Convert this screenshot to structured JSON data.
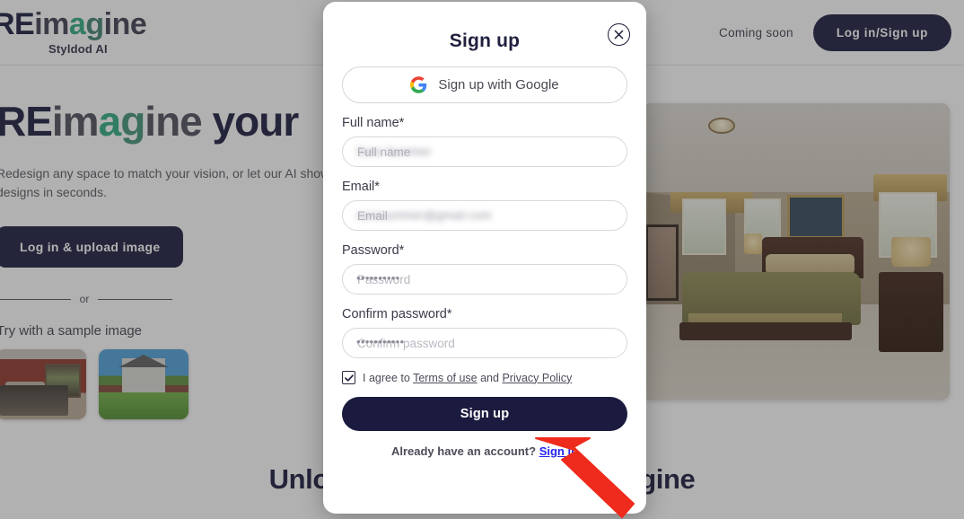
{
  "header": {
    "logo": {
      "part1": "RE",
      "part2": "im",
      "part3": "a",
      "part4": "g",
      "part5": "ine",
      "subtitle": "Styldod AI"
    },
    "coming_soon": "Coming soon",
    "login_button": "Log in/Sign up"
  },
  "hero": {
    "title": {
      "part1": "RE",
      "part2": "im",
      "part3": "a",
      "part4": "g",
      "part5": "ine",
      "part6": " your"
    },
    "subtitle": "Redesign any space to match your vision, or let our AI show you designs in seconds.",
    "cta_button": "Log in & upload image",
    "or_text": "or",
    "sample_label": "Try with a sample image",
    "thumbnails": [
      {
        "name": "red-bedroom-sample"
      },
      {
        "name": "house-exterior-sample"
      }
    ],
    "photo_alt": "bedroom interior photo"
  },
  "bottom": {
    "title": "Unlock creativity with REimagine",
    "subtitle": ""
  },
  "modal": {
    "title": "Sign up",
    "close_icon": "close-circle-icon",
    "google_button": "Sign up with Google",
    "fields": [
      {
        "label": "Full name*",
        "value": "Sara Summer",
        "placeholder": "Full name",
        "redacted": true,
        "type": "text",
        "name": "full-name"
      },
      {
        "label": "Email*",
        "value": "sarasummer@gmail.com",
        "placeholder": "Email",
        "redacted": true,
        "type": "email",
        "name": "email"
      },
      {
        "label": "Password*",
        "value": "••••••••••",
        "placeholder": "Password",
        "redacted": false,
        "type": "password",
        "name": "password"
      },
      {
        "label": "Confirm password*",
        "value": "•••••••••••",
        "placeholder": "Confirm password",
        "redacted": false,
        "type": "password",
        "name": "confirm-password"
      }
    ],
    "terms": {
      "checked": true,
      "prefix": "I agree to ",
      "terms_link": "Terms of use",
      "middle": " and ",
      "privacy_link": "Privacy Policy"
    },
    "submit_button": "Sign up",
    "footer_text": "Already have an account?",
    "signin_link": "Sign in"
  },
  "annotation": {
    "arrow_color": "#ee2b1c",
    "points_at": "sign-up-submit-button"
  },
  "colors": {
    "brand_dark": "#15153a",
    "brand_green": "#2aa87f",
    "link_blue": "#2323ee",
    "overlay": "rgba(60,60,60,0.40)"
  }
}
